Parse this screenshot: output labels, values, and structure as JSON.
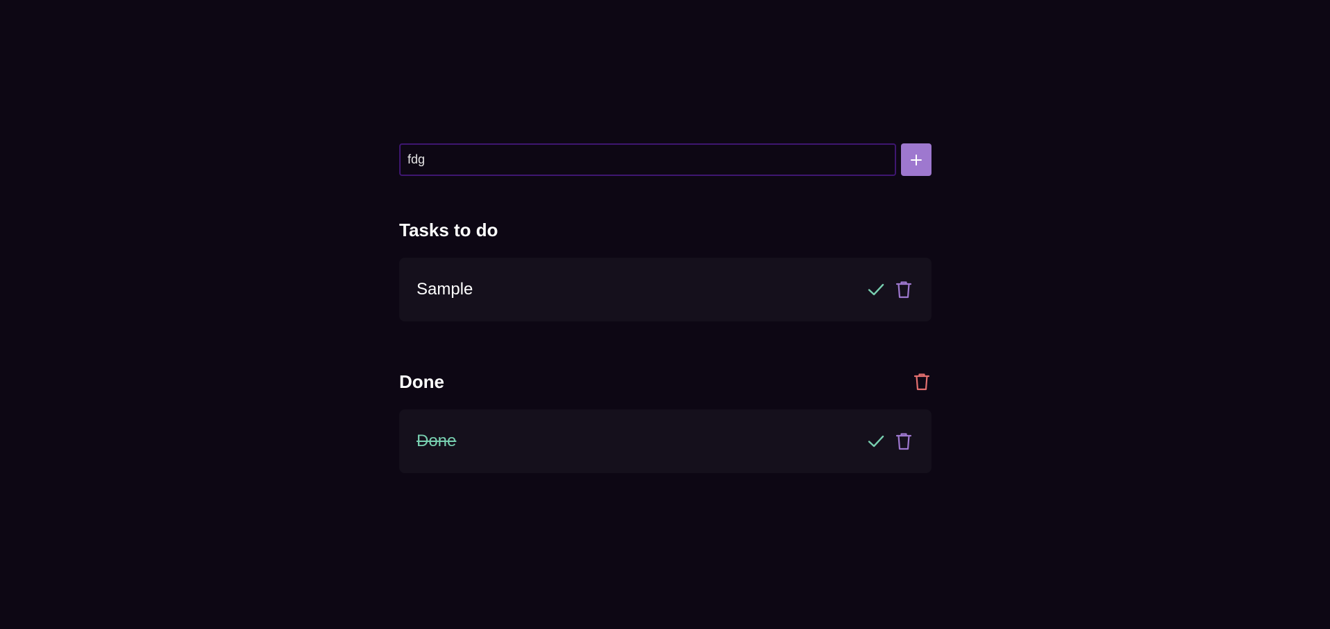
{
  "input": {
    "value": "fdg",
    "placeholder": ""
  },
  "add_button": {
    "icon": "plus-icon"
  },
  "todo": {
    "title": "Tasks to do",
    "items": [
      {
        "label": "Sample"
      }
    ]
  },
  "done": {
    "title": "Done",
    "items": [
      {
        "label": "Done"
      }
    ]
  },
  "colors": {
    "background": "#0d0714",
    "accent": "#9e78cf",
    "input_border": "#3e1671",
    "card": "#15101c",
    "check": "#78cfb0",
    "delete": "#9e78cf",
    "clear_all": "#e36f6f"
  }
}
